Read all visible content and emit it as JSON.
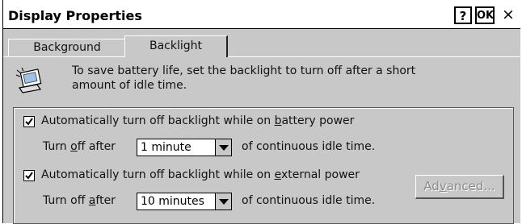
{
  "window": {
    "title": "Display Properties"
  },
  "titlebar_buttons": {
    "help": "?",
    "ok": "OK",
    "close": "×"
  },
  "tabs": [
    {
      "label": "Background"
    },
    {
      "label": "Backlight"
    }
  ],
  "info": {
    "line1": "To save battery life, set the backlight to turn off after a short",
    "line2": "amount of idle time."
  },
  "battery": {
    "checked": true,
    "label_pre": "Automatically turn off backlight while on ",
    "label_u": "b",
    "label_post": "attery power",
    "turnoff_pre": "Turn ",
    "turnoff_u": "o",
    "turnoff_post": "ff after",
    "duration": "1 minute",
    "suffix": "of continuous idle time."
  },
  "external": {
    "checked": true,
    "label_pre": "Automatically turn off backlight while on ",
    "label_u": "e",
    "label_post": "xternal power",
    "turnoff_pre": "Turn off ",
    "turnoff_u": "a",
    "turnoff_post": "fter",
    "duration": "10 minutes",
    "suffix": "of continuous idle time."
  },
  "advanced_button": {
    "pre": "Ad",
    "u": "v",
    "post": "anced..."
  }
}
